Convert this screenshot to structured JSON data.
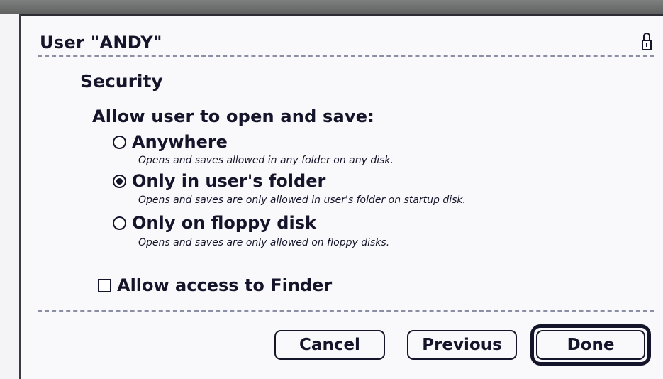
{
  "dialog": {
    "title": "User \"ANDY\"",
    "section": "Security",
    "heading": "Allow user to open and save:",
    "options": [
      {
        "label": "Anywhere",
        "description": "Opens and saves allowed in any folder on any disk.",
        "selected": false
      },
      {
        "label": "Only in user's folder",
        "description": "Opens and saves are only allowed in user's folder on startup disk.",
        "selected": true
      },
      {
        "label": "Only on floppy disk",
        "description": "Opens and saves are only allowed on floppy disks.",
        "selected": false
      }
    ],
    "finder_checkbox": {
      "label": "Allow access to Finder",
      "checked": false
    },
    "buttons": {
      "cancel": "Cancel",
      "previous": "Previous",
      "done": "Done"
    }
  }
}
